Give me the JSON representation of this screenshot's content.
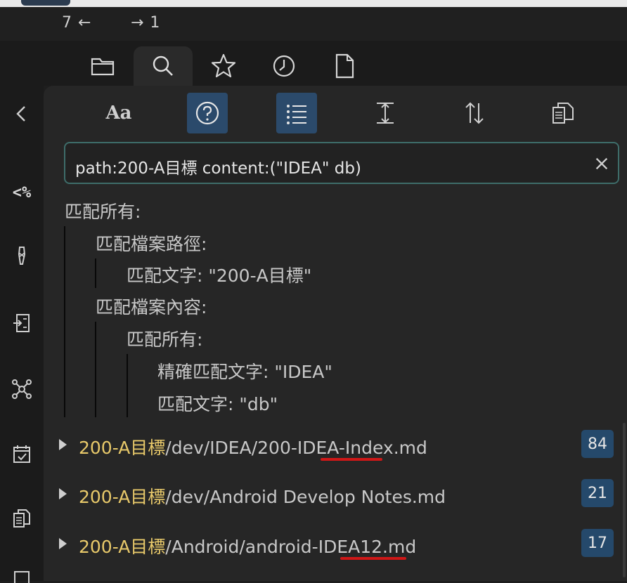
{
  "nav": {
    "back": "7 ←",
    "forward": "→ 1"
  },
  "left_rail": {
    "items": [
      {
        "name": "collapse-icon"
      },
      {
        "name": "percent-icon",
        "label": "<%"
      },
      {
        "name": "tag-icon"
      },
      {
        "name": "import-icon"
      },
      {
        "name": "graph-icon"
      },
      {
        "name": "calendar-check-icon"
      },
      {
        "name": "copy-icon"
      }
    ]
  },
  "tabs": [
    {
      "name": "folder-icon"
    },
    {
      "name": "search-icon",
      "active": true
    },
    {
      "name": "star-icon"
    },
    {
      "name": "clock-icon"
    },
    {
      "name": "file-icon"
    }
  ],
  "toolbar": {
    "match_case_label": "Aa",
    "buttons": [
      "match-case",
      "explain-query",
      "list-view",
      "collapse-expand",
      "sort",
      "copy-results"
    ],
    "accent": "#2b4a6b"
  },
  "search": {
    "value": "path:200-A目標 content:(\"IDEA\"  db)"
  },
  "explain": {
    "l0": "匹配所有:",
    "l1": "匹配檔案路徑:",
    "l2": "匹配文字: \"200-A目標\"",
    "l3": "匹配檔案內容:",
    "l4": "匹配所有:",
    "l5": "精確匹配文字: \"IDEA\"",
    "l6": "匹配文字: \"db\""
  },
  "results": [
    {
      "prefix": "200-A目標",
      "rest_a": "/dev/IDEA/200",
      "rest_b": "-IDEA-",
      "rest_c": "Index.md",
      "count": "84"
    },
    {
      "prefix": "200-A目標",
      "rest_a": "/dev/Android Develop Notes.md",
      "rest_b": "",
      "rest_c": "",
      "count": "21"
    },
    {
      "prefix": "200-A目標",
      "rest_a": "/Android/android",
      "rest_b": "-IDEA12",
      "rest_c": ".md",
      "count": "17"
    }
  ],
  "colors": {
    "highlight": "#e8c96a",
    "count_bg": "#25496b",
    "annotation_red": "#d01717"
  }
}
